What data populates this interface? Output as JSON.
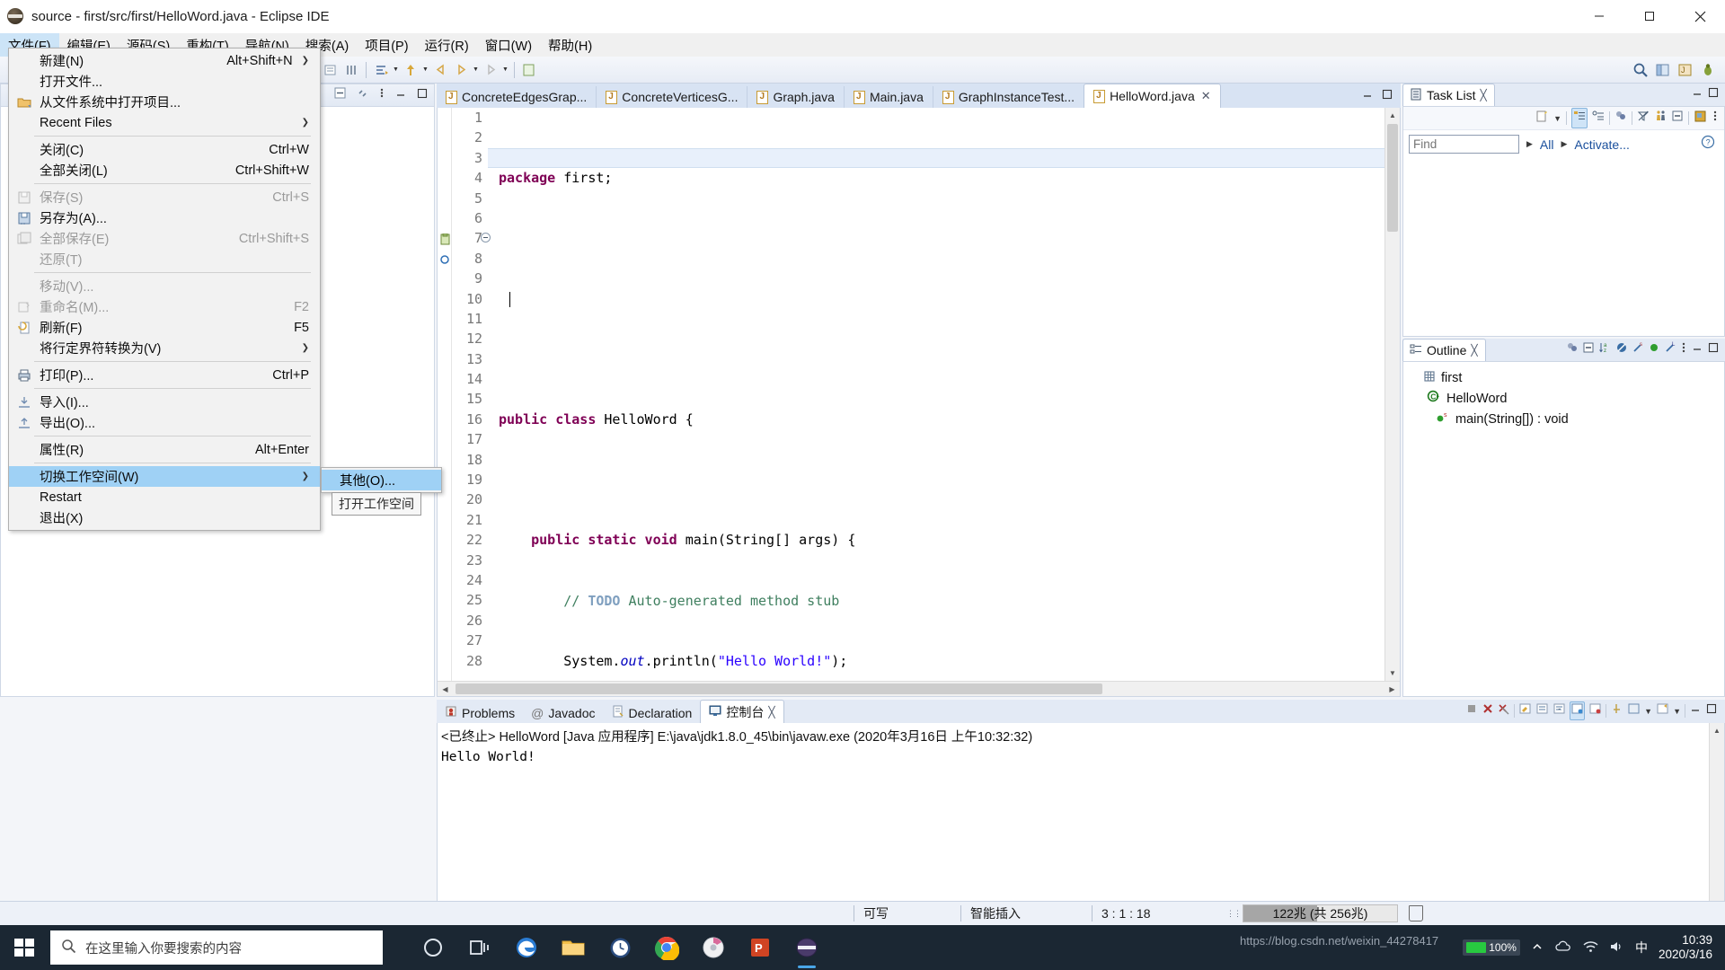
{
  "window": {
    "title": "source - first/src/first/HelloWord.java - Eclipse IDE",
    "app_icon": "eclipse-icon",
    "minimize": "–",
    "maximize": "□",
    "close": "✕"
  },
  "menubar": {
    "items": [
      {
        "label": "文件(F)",
        "name": "menu-file",
        "active": true
      },
      {
        "label": "编辑(E)",
        "name": "menu-edit",
        "active": false
      },
      {
        "label": "源码(S)",
        "name": "menu-source",
        "active": false
      },
      {
        "label": "重构(T)",
        "name": "menu-refactor",
        "active": false
      },
      {
        "label": "导航(N)",
        "name": "menu-navigate",
        "active": false
      },
      {
        "label": "搜索(A)",
        "name": "menu-search",
        "active": false
      },
      {
        "label": "项目(P)",
        "name": "menu-project",
        "active": false
      },
      {
        "label": "运行(R)",
        "name": "menu-run",
        "active": false
      },
      {
        "label": "窗口(W)",
        "name": "menu-window",
        "active": false
      },
      {
        "label": "帮助(H)",
        "name": "menu-help",
        "active": false
      }
    ]
  },
  "file_menu": {
    "items": [
      {
        "label": "新建(N)",
        "accel": "Alt+Shift+N",
        "submenu": true,
        "disabled": false,
        "icon": null
      },
      {
        "label": "打开文件...",
        "accel": "",
        "submenu": false,
        "disabled": false,
        "icon": null
      },
      {
        "label": "从文件系统中打开项目...",
        "accel": "",
        "submenu": false,
        "disabled": false,
        "icon": "folder-icon"
      },
      {
        "label": "Recent Files",
        "accel": "",
        "submenu": true,
        "disabled": false,
        "icon": null
      },
      {
        "separator": true
      },
      {
        "label": "关闭(C)",
        "accel": "Ctrl+W",
        "submenu": false,
        "disabled": false,
        "icon": null
      },
      {
        "label": "全部关闭(L)",
        "accel": "Ctrl+Shift+W",
        "submenu": false,
        "disabled": false,
        "icon": null
      },
      {
        "separator": true
      },
      {
        "label": "保存(S)",
        "accel": "Ctrl+S",
        "submenu": false,
        "disabled": true,
        "icon": "save-icon"
      },
      {
        "label": "另存为(A)...",
        "accel": "",
        "submenu": false,
        "disabled": false,
        "icon": "save-as-icon"
      },
      {
        "label": "全部保存(E)",
        "accel": "Ctrl+Shift+S",
        "submenu": false,
        "disabled": true,
        "icon": "save-all-icon"
      },
      {
        "label": "还原(T)",
        "accel": "",
        "submenu": false,
        "disabled": true,
        "icon": null
      },
      {
        "separator": true
      },
      {
        "label": "移动(V)...",
        "accel": "",
        "submenu": false,
        "disabled": true,
        "icon": null
      },
      {
        "label": "重命名(M)...",
        "accel": "F2",
        "submenu": false,
        "disabled": true,
        "icon": "rename-icon"
      },
      {
        "label": "刷新(F)",
        "accel": "F5",
        "submenu": false,
        "disabled": false,
        "icon": "refresh-icon"
      },
      {
        "label": "将行定界符转换为(V)",
        "accel": "",
        "submenu": true,
        "disabled": false,
        "icon": null
      },
      {
        "separator": true
      },
      {
        "label": "打印(P)...",
        "accel": "Ctrl+P",
        "submenu": false,
        "disabled": false,
        "icon": "print-icon"
      },
      {
        "separator": true
      },
      {
        "label": "导入(I)...",
        "accel": "",
        "submenu": false,
        "disabled": false,
        "icon": "import-icon"
      },
      {
        "label": "导出(O)...",
        "accel": "",
        "submenu": false,
        "disabled": false,
        "icon": "export-icon"
      },
      {
        "separator": true
      },
      {
        "label": "属性(R)",
        "accel": "Alt+Enter",
        "submenu": false,
        "disabled": false,
        "icon": null
      },
      {
        "separator": true
      },
      {
        "label": "切换工作空间(W)",
        "accel": "",
        "submenu": true,
        "disabled": false,
        "icon": null,
        "selected": true
      },
      {
        "label": "Restart",
        "accel": "",
        "submenu": false,
        "disabled": false,
        "icon": null
      },
      {
        "label": "退出(X)",
        "accel": "",
        "submenu": false,
        "disabled": false,
        "icon": null
      }
    ],
    "submenu": {
      "items": [
        {
          "label": "其他(O)...",
          "selected": true
        }
      ]
    },
    "tooltip": "打开工作空间"
  },
  "editor": {
    "tabs": [
      {
        "label": "ConcreteEdgesGrap...",
        "active": false,
        "closable": false
      },
      {
        "label": "ConcreteVerticesG...",
        "active": false,
        "closable": false
      },
      {
        "label": "Graph.java",
        "active": false,
        "closable": false
      },
      {
        "label": "Main.java",
        "active": false,
        "closable": false
      },
      {
        "label": "GraphInstanceTest...",
        "active": false,
        "closable": false
      },
      {
        "label": "HelloWord.java",
        "active": true,
        "closable": true,
        "close": "✕"
      }
    ],
    "line_numbers": [
      "1",
      "2",
      "3",
      "4",
      "5",
      "6",
      "7",
      "8",
      "9",
      "10",
      "11",
      "12",
      "13",
      "14",
      "15",
      "16",
      "17",
      "18",
      "19",
      "20",
      "21",
      "22",
      "23",
      "24",
      "25",
      "26",
      "27",
      "28"
    ],
    "cursor_line": 3,
    "fold_line": 7,
    "code_lines": [
      "package first;",
      "",
      "",
      "",
      "public class HelloWord {",
      "",
      "    public static void main(String[] args) {",
      "        // TODO Auto-generated method stub",
      "        System.out.println(\"Hello World!\");",
      "    }",
      "}"
    ]
  },
  "task_list": {
    "tab_label": "Task List",
    "tab_close": "╳",
    "find_value": "",
    "find_placeholder": "Find",
    "filter_all": "All",
    "activate": "Activate...",
    "help_icon": "help-icon"
  },
  "outline": {
    "tab_label": "Outline",
    "tab_close": "╳",
    "rows": [
      {
        "label": "first",
        "icon": "package-icon",
        "indent": 22,
        "expander": ""
      },
      {
        "label": "HelloWord",
        "icon": "class-icon",
        "indent": 8,
        "expander": "ⱟ"
      },
      {
        "label": "main(String[]) : void",
        "icon": "method-icon",
        "indent": 36,
        "expander": ""
      }
    ]
  },
  "console": {
    "tabs": [
      {
        "label": "Problems",
        "icon": "problems-icon",
        "active": false
      },
      {
        "label": "Javadoc",
        "icon": "javadoc-icon",
        "active": false
      },
      {
        "label": "Declaration",
        "icon": "declaration-icon",
        "active": false
      },
      {
        "label": "控制台",
        "icon": "console-icon",
        "active": true,
        "close": "╳"
      }
    ],
    "header": "<已终止> HelloWord [Java 应用程序] E:\\java\\jdk1.8.0_45\\bin\\javaw.exe  (2020年3月16日 上午10:32:32)",
    "output": "Hello World!"
  },
  "status_bar": {
    "writable": "可写",
    "insert_mode": "智能插入",
    "position": "3 : 1 : 18",
    "heap": "122兆 (共 256兆)",
    "heap_percent": 48,
    "trash_icon": "trash-icon"
  },
  "taskbar": {
    "start_icon": "windows-start-icon",
    "search_placeholder": "在这里输入你要搜索的内容",
    "search_icon": "search-icon",
    "apps": [
      {
        "name": "cortana-icon"
      },
      {
        "name": "task-view-icon"
      },
      {
        "name": "edge-icon"
      },
      {
        "name": "file-explorer-icon"
      },
      {
        "name": "clock-icon"
      },
      {
        "name": "chrome-icon"
      },
      {
        "name": "disc-icon"
      },
      {
        "name": "powerpoint-icon"
      },
      {
        "name": "eclipse-icon"
      }
    ],
    "tray": {
      "battery_percent": "100%",
      "chevron_icon": "chevron-up-icon",
      "cloud_icon": "cloud-icon",
      "network_icon": "network-icon",
      "volume_icon": "volume-icon",
      "ime_icon": "ime-icon"
    },
    "clock_time": "10:39",
    "clock_date": "2020/3/16"
  },
  "watermark": "https://blog.csdn.net/weixin_44278417"
}
